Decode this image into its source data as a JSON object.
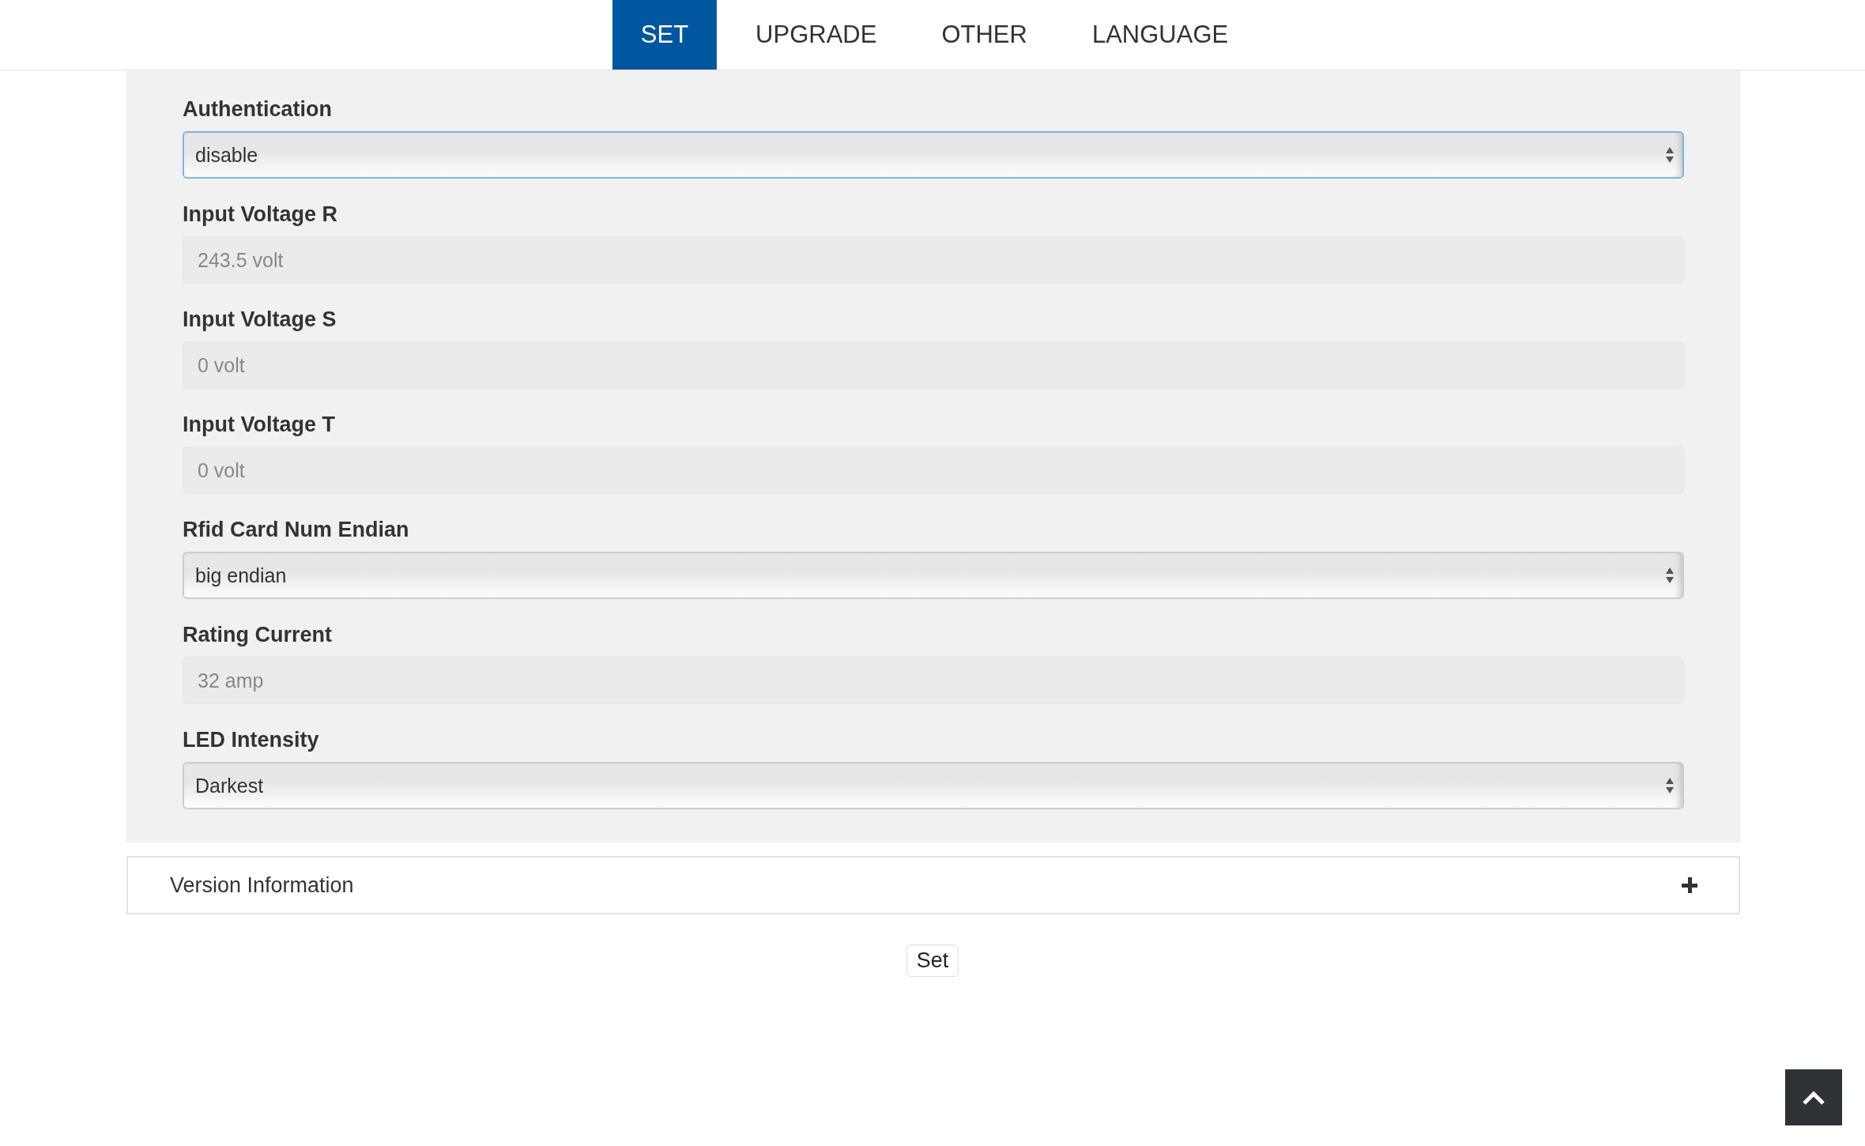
{
  "tabs": [
    {
      "label": "SET",
      "selected": true
    },
    {
      "label": "UPGRADE",
      "selected": false
    },
    {
      "label": "OTHER",
      "selected": false
    },
    {
      "label": "LANGUAGE",
      "selected": false
    }
  ],
  "fields": [
    {
      "kind": "select",
      "label": "Authentication",
      "value": "disable",
      "focused": true
    },
    {
      "kind": "readonly",
      "label": "Input Voltage R",
      "value": "243.5 volt"
    },
    {
      "kind": "readonly",
      "label": "Input Voltage S",
      "value": "0 volt"
    },
    {
      "kind": "readonly",
      "label": "Input Voltage T",
      "value": "0 volt"
    },
    {
      "kind": "select",
      "label": "Rfid Card Num Endian",
      "value": "big endian",
      "focused": false
    },
    {
      "kind": "readonly",
      "label": "Rating Current",
      "value": "32 amp"
    },
    {
      "kind": "select",
      "label": "LED Intensity",
      "value": "Darkest",
      "focused": false
    }
  ],
  "version_panel": {
    "title": "Version Information",
    "expanded": false
  },
  "set_button": {
    "label": "Set"
  }
}
